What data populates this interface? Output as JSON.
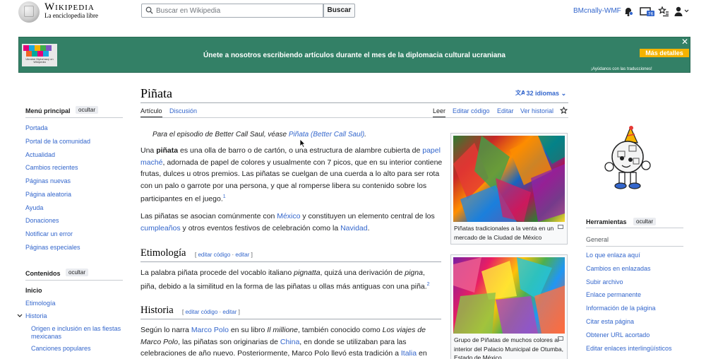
{
  "header": {
    "wordmark": "Wikipedia",
    "tagline": "La enciclopedia libre",
    "search_placeholder": "Buscar en Wikipedia",
    "search_button": "Buscar",
    "username": "BMcnally-WMF",
    "notification_count": "76"
  },
  "banner": {
    "logo_text": "Únete a nosotros escribiendo artículos durante el mes de la diplomacia cultural ucraniana",
    "message": "Únete a nosotros escribiendo artículos durante el mes de la diplomacia cultural ucraniana",
    "more_button": "Más detalles",
    "close": "✕",
    "help_text": "¡Ayúdanos con las traducciones!",
    "logo_label": "Ukraine Diplomacy on Wikipedia"
  },
  "left_sidebar": {
    "main_menu_title": "Menú principal",
    "hide_label": "ocultar",
    "nav_items": [
      "Portada",
      "Portal de la comunidad",
      "Actualidad",
      "Cambios recientes",
      "Páginas nuevas",
      "Página aleatoria",
      "Ayuda",
      "Donaciones",
      "Notificar un error",
      "Páginas especiales"
    ],
    "toc_title": "Contenidos",
    "toc_hide": "ocultar",
    "toc_items": [
      "Inicio",
      "Etimología",
      "Historia"
    ],
    "toc_sub_items": [
      "Origen e inclusión en las fiestas mexicanas",
      "Canciones populares"
    ]
  },
  "article": {
    "title": "Piñata",
    "languages": "32 idiomas",
    "tabs_left": [
      "Artículo",
      "Discusión"
    ],
    "tabs_right": [
      "Leer",
      "Editar código",
      "Editar",
      "Ver historial"
    ],
    "hatnote_prefix": "Para el episodio de Better Call Saul, véase ",
    "hatnote_link": "Piñata (Better Call Saul)",
    "hatnote_suffix": ".",
    "p1": {
      "t1": "Una ",
      "bold": "piñata",
      "t2": " es una olla de barro o de cartón, o una estructura de alambre cubierta de ",
      "link1": "papel maché",
      "t3": ", adornada de papel de colores y usualmente con 7 picos, que en su interior contiene frutas, dulces u otros premios. Las piñatas se cuelgan de una cuerda a lo alto para ser rota con un palo o garrote por una persona, y que al romperse libera su contenido sobre los participantes en el juego.",
      "ref": "1"
    },
    "p2": {
      "t1": "Las piñatas se asocian comúnmente con ",
      "link1": "México",
      "t2": " y constituyen un elemento central de los ",
      "link2": "cumpleaños",
      "t3": " y otros eventos festivos de celebración como la ",
      "link3": "Navidad",
      "t4": "."
    },
    "h_etimologia": "Etimología",
    "edit_links": {
      "open": "[ ",
      "code": "editar código",
      "sep": " · ",
      "edit": "editar",
      "close": " ]"
    },
    "p3": {
      "t1": "La palabra piñata procede del vocablo italiano ",
      "i1": "pignatta",
      "t2": ", quizá una derivación de ",
      "i2": "pigna",
      "t3": ", piña, debido a la similitud en la forma de las piñatas u ollas más antiguas con una piña.",
      "ref": "2"
    },
    "h_historia": "Historia",
    "p4": {
      "t1": "Según lo narra ",
      "link1": "Marco Polo",
      "t2": " en su libro ",
      "i1": "Il millione",
      "t3": ", también conocido como ",
      "i2": "Los viajes de Marco Polo",
      "t4": ", las piñatas son originarias de ",
      "link2": "China",
      "t5": ", en donde se utilizaban para las celebraciones de año nuevo. Posteriormente, Marco Polo llevó esta tradición a ",
      "link3": "Italia",
      "t6": " en donde se adaptó a las"
    },
    "thumb1_caption": "Piñatas tradicionales a la venta en un mercado de la Ciudad de México",
    "thumb2_caption": "Grupo de Piñatas de muchos colores al interior del Palacio Municipal de Otumba, Estado de México."
  },
  "right_sidebar": {
    "tools_title": "Herramientas",
    "hide_label": "ocultar",
    "general": "General",
    "links": [
      "Lo que enlaza aquí",
      "Cambios en enlazadas",
      "Subir archivo",
      "Enlace permanente",
      "Información de la página",
      "Citar esta página",
      "Obtener URL acortado",
      "Editar enlaces interlingüísticos"
    ]
  },
  "colors": {
    "link": "#3366cc",
    "banner_bg": "#338066",
    "banner_button": "#f5b301"
  }
}
